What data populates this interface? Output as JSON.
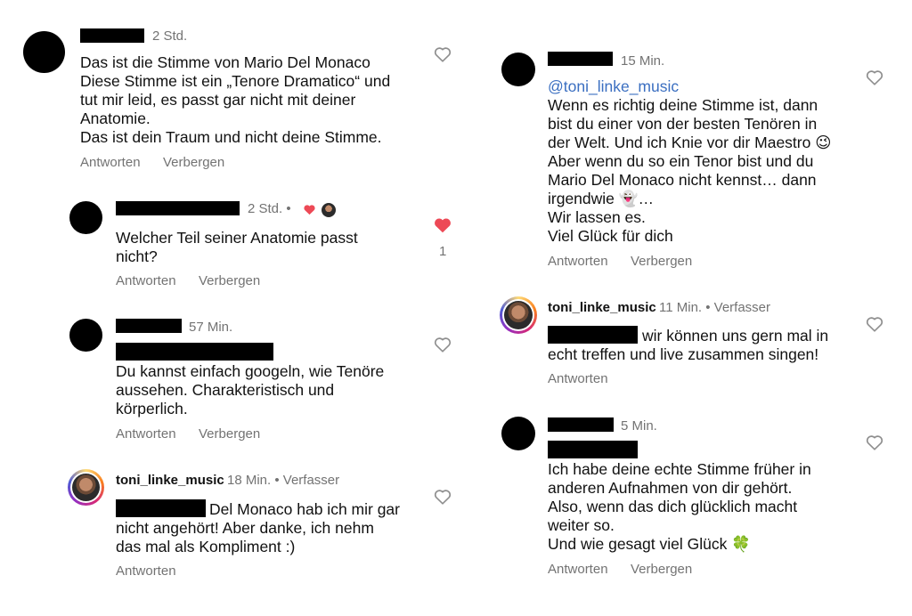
{
  "actions": {
    "reply": "Antworten",
    "hide": "Verbergen"
  },
  "left": {
    "c1": {
      "time": "2 Std.",
      "text": "Das ist die Stimme von Mario Del Monaco\nDiese Stimme ist ein „Tenore Dramatico“ und\ntut mir leid, es passt gar nicht mit deiner\nAnatomie.\nDas ist dein Traum und nicht deine Stimme."
    },
    "c2": {
      "time": "2 Std. •",
      "text": "Welcher Teil seiner Anatomie passt\nnicht?",
      "likes": "1"
    },
    "c3": {
      "time": "57 Min.",
      "text": "Du kannst einfach googeln, wie Tenöre\naussehen. Charakteristisch und\nkörperlich."
    },
    "c4": {
      "username": "toni_linke_music",
      "time": "18 Min. • Verfasser",
      "text_line1": "Del Monaco hab ich mir gar",
      "text_rest": "nicht angehört! Aber danke, ich nehm\ndas mal als Kompliment :)"
    }
  },
  "right": {
    "c1": {
      "time": "15 Min.",
      "mention": "@toni_linke_music",
      "text": "Wenn es richtig deine Stimme ist, dann\nbist du einer von der besten Tenören in\nder Welt. Und ich Knie vor dir Maestro 😉\nAber wenn du so ein Tenor bist und du\nMario Del Monaco nicht kennst… dann\nirgendwie 👻…\nWir lassen es.\nViel Glück für dich"
    },
    "c2": {
      "username": "toni_linke_music",
      "time": "11 Min. • Verfasser",
      "text_line1": "wir können uns gern mal in",
      "text_rest": "echt treffen und live zusammen singen!"
    },
    "c3": {
      "time": "5 Min.",
      "text": "Ich habe deine echte Stimme früher in\nanderen Aufnahmen von dir gehört.\nAlso, wenn das dich glücklich macht\nweiter so.\nUnd wie gesagt viel Glück 🍀"
    }
  },
  "colors": {
    "like_red": "#ed4956",
    "meta_gray": "#737373",
    "mention_blue": "#3b6fc1"
  },
  "icons": {
    "heart": "heart-outline-icon",
    "liked": "heart-filled-icon"
  }
}
